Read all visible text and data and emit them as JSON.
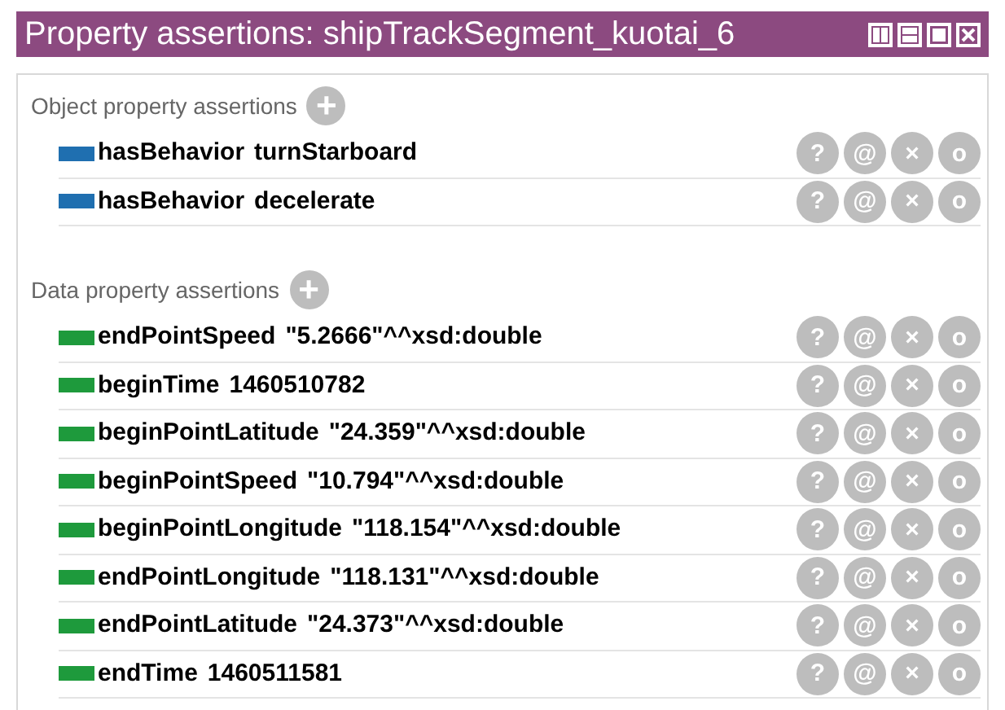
{
  "window": {
    "title": "Property assertions: shipTrackSegment_kuotai_6"
  },
  "sections": [
    {
      "title": "Object property assertions",
      "add": "+",
      "color": "#1f6fb0",
      "rows": [
        {
          "property": "hasBehavior",
          "value": "turnStarboard",
          "actions": [
            "?",
            "@",
            "×",
            "o"
          ]
        },
        {
          "property": "hasBehavior",
          "value": "decelerate",
          "actions": [
            "?",
            "@",
            "×",
            "o"
          ]
        }
      ]
    },
    {
      "title": "Data property assertions",
      "add": "+",
      "color": "#1e9a3c",
      "rows": [
        {
          "property": "endPointSpeed",
          "value": "\"5.2666\"^^xsd:double",
          "actions": [
            "?",
            "@",
            "×",
            "o"
          ]
        },
        {
          "property": "beginTime",
          "value": "1460510782",
          "actions": [
            "?",
            "@",
            "×",
            "o"
          ]
        },
        {
          "property": "beginPointLatitude",
          "value": "\"24.359\"^^xsd:double",
          "actions": [
            "?",
            "@",
            "×",
            "o"
          ]
        },
        {
          "property": "beginPointSpeed",
          "value": "\"10.794\"^^xsd:double",
          "actions": [
            "?",
            "@",
            "×",
            "o"
          ]
        },
        {
          "property": "beginPointLongitude",
          "value": "\"118.154\"^^xsd:double",
          "actions": [
            "?",
            "@",
            "×",
            "o"
          ]
        },
        {
          "property": "endPointLongitude",
          "value": "\"118.131\"^^xsd:double",
          "actions": [
            "?",
            "@",
            "×",
            "o"
          ]
        },
        {
          "property": "endPointLatitude",
          "value": "\"24.373\"^^xsd:double",
          "actions": [
            "?",
            "@",
            "×",
            "o"
          ]
        },
        {
          "property": "endTime",
          "value": "1460511581",
          "actions": [
            "?",
            "@",
            "×",
            "o"
          ]
        }
      ]
    }
  ]
}
